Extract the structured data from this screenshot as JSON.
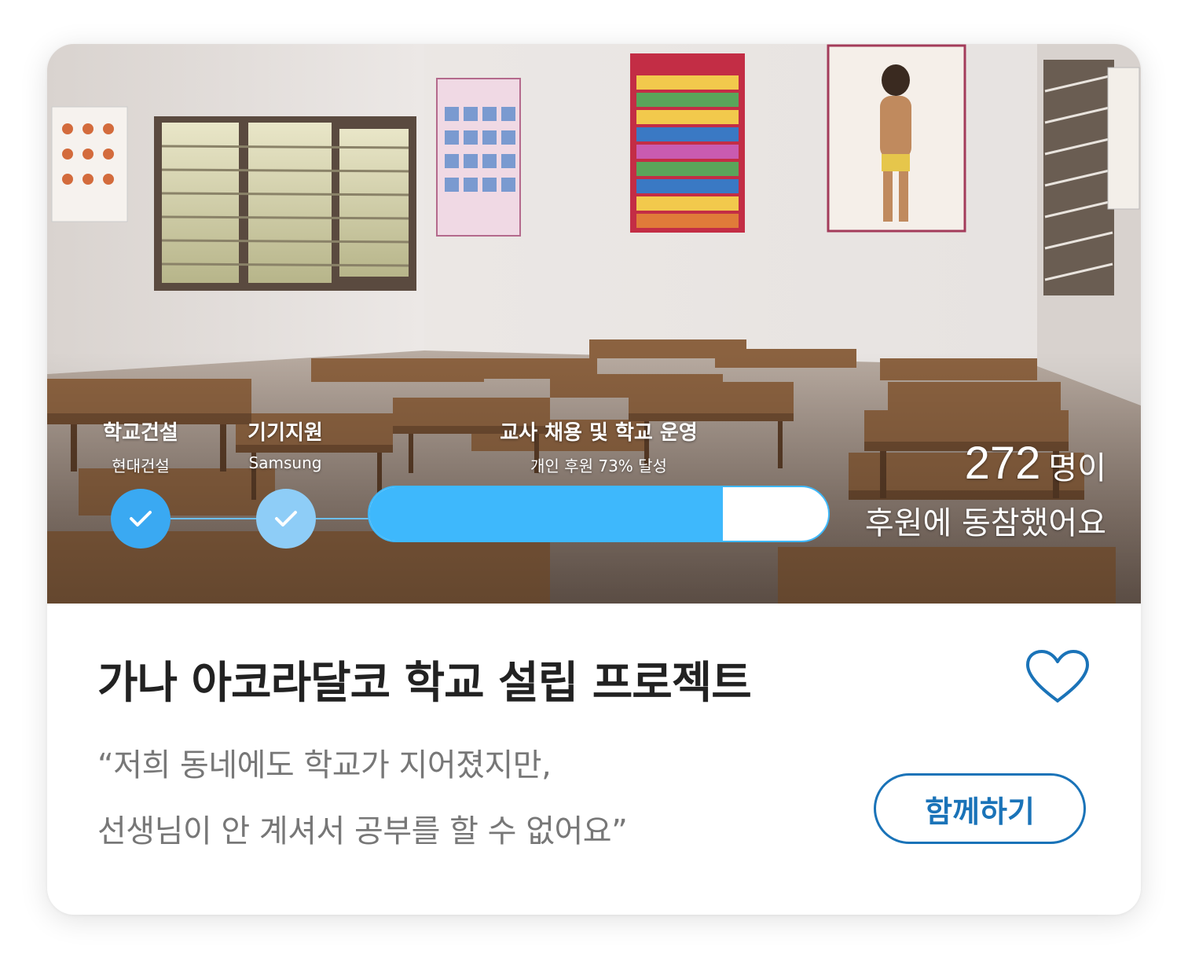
{
  "project": {
    "title": "가나 아코라달코 학교 설립 프로젝트",
    "quote_line1": "“저희 동네에도 학교가 지어졌지만,",
    "quote_line2": "선생님이 안 계셔서 공부를 할 수 없어요”",
    "join_label": "함께하기"
  },
  "stages": [
    {
      "title": "학교건설",
      "sub": "현대건설",
      "status": "complete"
    },
    {
      "title": "기기지원",
      "sub": "Samsung",
      "status": "complete"
    },
    {
      "title": "교사 채용 및 학교 운영",
      "sub": "개인 후원 73% 달성",
      "status": "in-progress",
      "progress": 0.77
    }
  ],
  "supporters": {
    "count": "272",
    "unit": "명이",
    "caption": "후원에 동참했어요"
  },
  "colors": {
    "accent": "#1a73b8",
    "progress": "#3eb8fc",
    "step_done": "#3aa9f2",
    "step_done_light": "#8ecdf7"
  },
  "icons": {
    "like": "heart-outline-icon",
    "step_check": "check-icon"
  }
}
